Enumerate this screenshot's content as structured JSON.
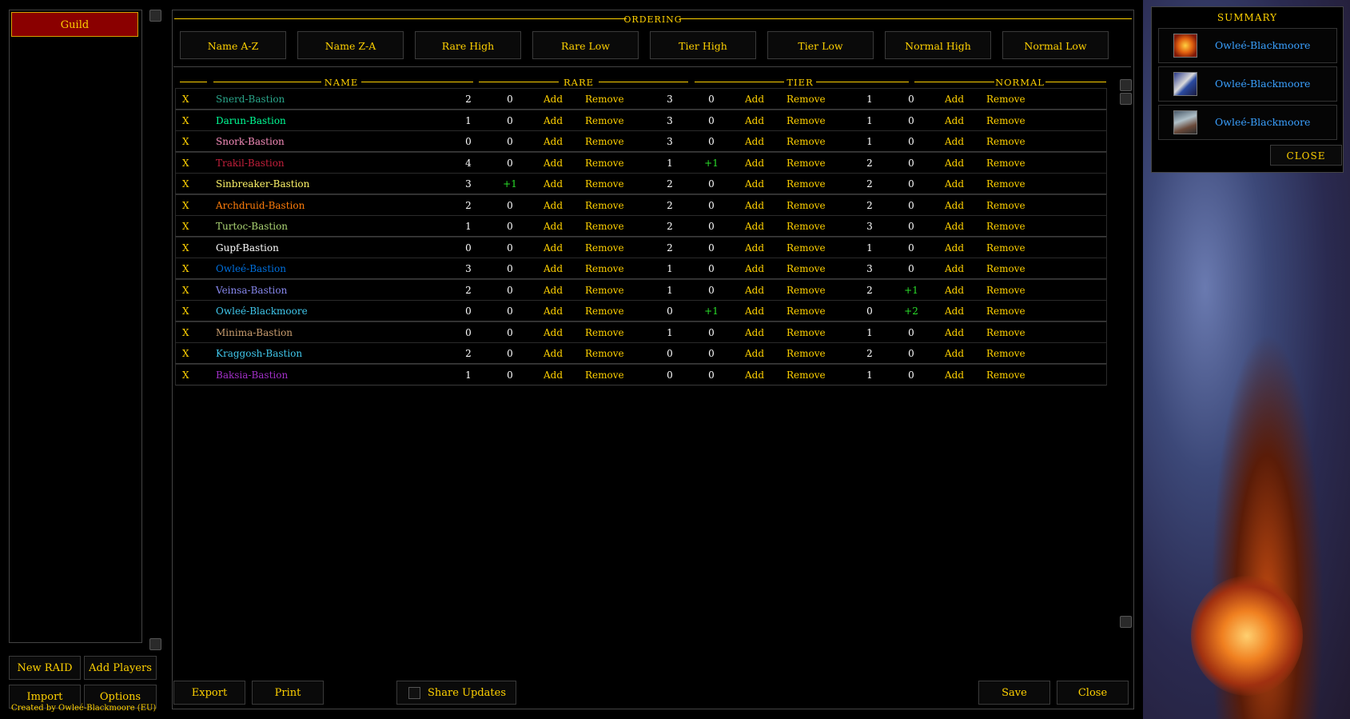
{
  "sidebar": {
    "guild_label": "Guild",
    "new_raid_label": "New RAID",
    "add_players_label": "Add Players",
    "import_label": "Import",
    "options_label": "Options",
    "credit": "Created by Owleé-Blackmoore (EU)"
  },
  "ordering": {
    "title": "ORDERING",
    "buttons": [
      "Name A-Z",
      "Name Z-A",
      "Rare High",
      "Rare Low",
      "Tier High",
      "Tier Low",
      "Normal High",
      "Normal Low"
    ]
  },
  "table": {
    "headers": {
      "name": "NAME",
      "rare": "RARE",
      "tier": "TIER",
      "normal": "NORMAL"
    },
    "x_label": "X",
    "add_label": "Add",
    "remove_label": "Remove",
    "rows": [
      {
        "name": "Snerd-Bastion",
        "color": "#2aa58a",
        "rare": "2",
        "rare_d": "0",
        "tier": "3",
        "tier_d": "0",
        "normal": "1",
        "normal_d": "0"
      },
      {
        "name": "Darun-Bastion",
        "color": "#00ff96",
        "rare": "1",
        "rare_d": "0",
        "tier": "3",
        "tier_d": "0",
        "normal": "1",
        "normal_d": "0"
      },
      {
        "name": "Snork-Bastion",
        "color": "#f58cba",
        "rare": "0",
        "rare_d": "0",
        "tier": "3",
        "tier_d": "0",
        "normal": "1",
        "normal_d": "0"
      },
      {
        "name": "Trakil-Bastion",
        "color": "#c41f3b",
        "rare": "4",
        "rare_d": "0",
        "tier": "1",
        "tier_d": "+1",
        "normal": "2",
        "normal_d": "0"
      },
      {
        "name": "Sinbreaker-Bastion",
        "color": "#fff569",
        "rare": "3",
        "rare_d": "+1",
        "tier": "2",
        "tier_d": "0",
        "normal": "2",
        "normal_d": "0"
      },
      {
        "name": "Archdruid-Bastion",
        "color": "#ff7d0a",
        "rare": "2",
        "rare_d": "0",
        "tier": "2",
        "tier_d": "0",
        "normal": "2",
        "normal_d": "0"
      },
      {
        "name": "Turtoc-Bastion",
        "color": "#abd473",
        "rare": "1",
        "rare_d": "0",
        "tier": "2",
        "tier_d": "0",
        "normal": "3",
        "normal_d": "0"
      },
      {
        "name": "Gupf-Bastion",
        "color": "#ffffff",
        "rare": "0",
        "rare_d": "0",
        "tier": "2",
        "tier_d": "0",
        "normal": "1",
        "normal_d": "0"
      },
      {
        "name": "Owleé-Bastion",
        "color": "#0070de",
        "rare": "3",
        "rare_d": "0",
        "tier": "1",
        "tier_d": "0",
        "normal": "3",
        "normal_d": "0"
      },
      {
        "name": "Veinsa-Bastion",
        "color": "#8787ed",
        "rare": "2",
        "rare_d": "0",
        "tier": "1",
        "tier_d": "0",
        "normal": "2",
        "normal_d": "+1"
      },
      {
        "name": "Owleé-Blackmoore",
        "color": "#40c7eb",
        "rare": "0",
        "rare_d": "0",
        "tier": "0",
        "tier_d": "+1",
        "normal": "0",
        "normal_d": "+2"
      },
      {
        "name": "Minima-Bastion",
        "color": "#c79c6e",
        "rare": "0",
        "rare_d": "0",
        "tier": "1",
        "tier_d": "0",
        "normal": "1",
        "normal_d": "0"
      },
      {
        "name": "Kraggosh-Bastion",
        "color": "#40c7eb",
        "rare": "2",
        "rare_d": "0",
        "tier": "0",
        "tier_d": "0",
        "normal": "2",
        "normal_d": "0"
      },
      {
        "name": "Baksia-Bastion",
        "color": "#a330c9",
        "rare": "1",
        "rare_d": "0",
        "tier": "0",
        "tier_d": "0",
        "normal": "1",
        "normal_d": "0"
      }
    ]
  },
  "footer": {
    "export_label": "Export",
    "print_label": "Print",
    "share_label": "Share Updates",
    "save_label": "Save",
    "close_label": "Close"
  },
  "summary": {
    "title": "SUMMARY",
    "items": [
      {
        "name": "Owleé-Blackmoore",
        "icon": "fire-gem-icon"
      },
      {
        "name": "Owleé-Blackmoore",
        "icon": "shoulder-armor-icon"
      },
      {
        "name": "Owleé-Blackmoore",
        "icon": "chest-armor-icon"
      }
    ],
    "close_label": "CLOSE"
  },
  "colors": {
    "accent": "#ffd100",
    "selected": "#8a0000",
    "increase": "#2adf2a"
  }
}
